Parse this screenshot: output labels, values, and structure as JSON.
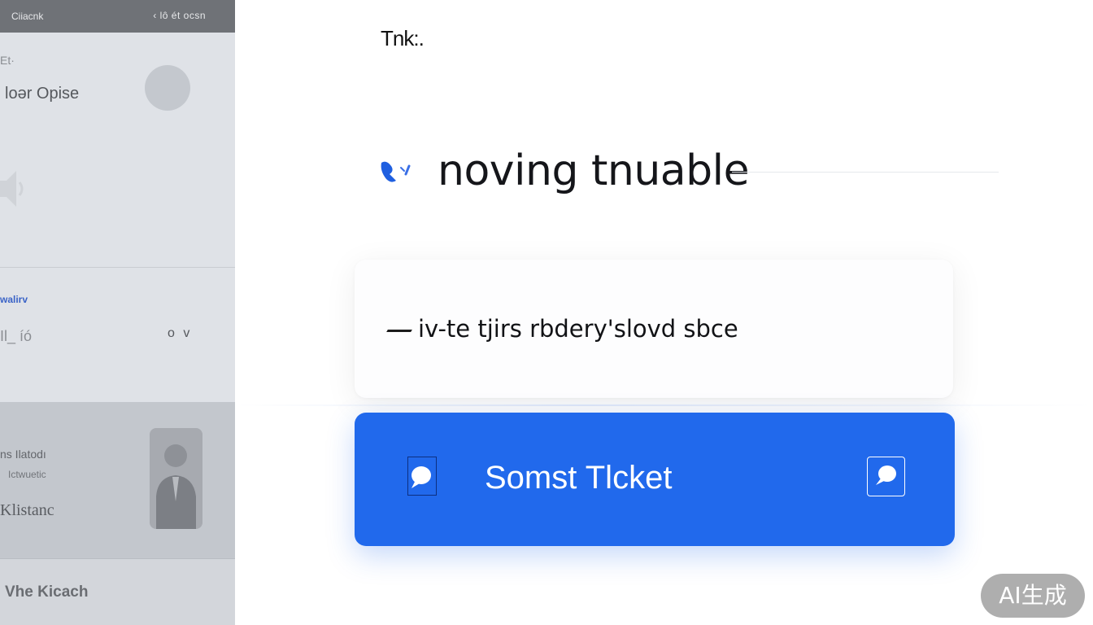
{
  "sidebar": {
    "topbar": {
      "left_text": "Ciiacnk",
      "right_text": "‹ lô ét ocsn"
    },
    "section1": {
      "label": "Et·",
      "title": "loǝr Opise"
    },
    "section2": {
      "link": "walirv",
      "value": "Il_ íó",
      "control": "o v"
    },
    "section3": {
      "name": "ns Ilatodı",
      "sub": "Ictwuetic",
      "title": "Klistanc"
    },
    "section4": {
      "text": "Vhe Kicach"
    }
  },
  "main": {
    "header": "Tnk:.",
    "title": "noving tnuable",
    "message": "iv-te tjirs rbdery'slovd sbce",
    "submit_label": "Somst Tlcket"
  },
  "badge": "AI生成",
  "colors": {
    "accent": "#2169ec",
    "sidebar_bg": "#dfe2e7",
    "topbar_bg": "#6f7277",
    "text_dark": "#15161a"
  }
}
